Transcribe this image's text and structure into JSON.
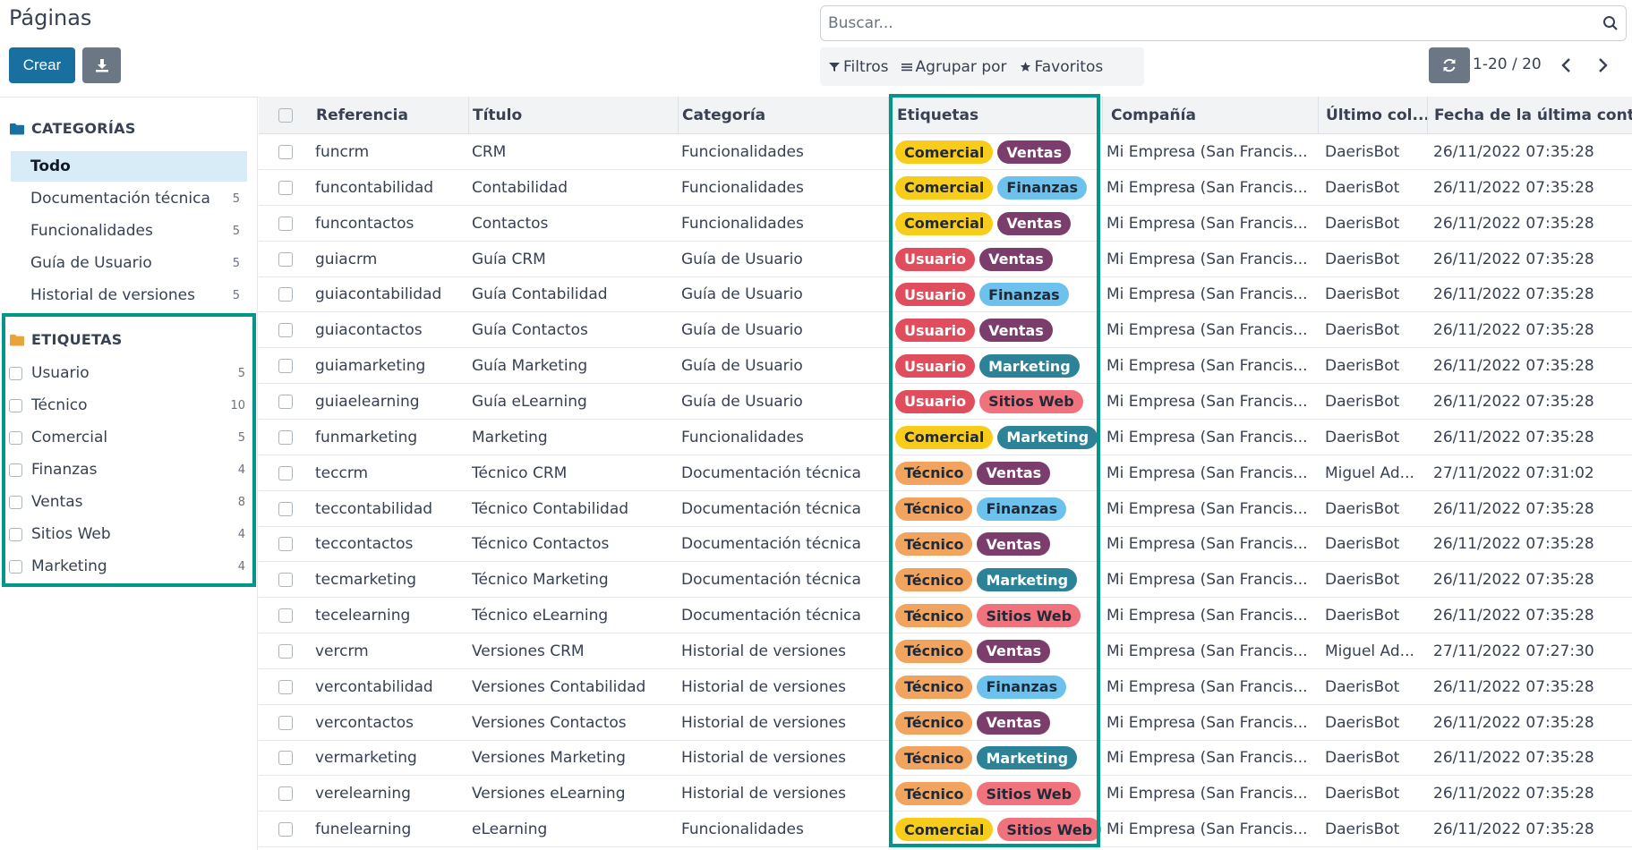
{
  "page": {
    "title": "Páginas"
  },
  "toolbar": {
    "create_label": "Crear",
    "download_icon": "download-icon",
    "refresh_icon": "refresh-icon"
  },
  "search": {
    "placeholder": "Buscar..."
  },
  "filters": {
    "filtros": "Filtros",
    "agrupar": "Agrupar por",
    "favoritos": "Favoritos"
  },
  "pager": {
    "text": "1-20 / 20"
  },
  "sidebar": {
    "categories_title": "CATEGORÍAS",
    "categories": [
      {
        "label": "Todo",
        "count": ""
      },
      {
        "label": "Documentación técnica",
        "count": "5"
      },
      {
        "label": "Funcionalidades",
        "count": "5"
      },
      {
        "label": "Guía de Usuario",
        "count": "5"
      },
      {
        "label": "Historial de versiones",
        "count": "5"
      }
    ],
    "tags_title": "ETIQUETAS",
    "tags": [
      {
        "label": "Usuario",
        "count": "5"
      },
      {
        "label": "Técnico",
        "count": "10"
      },
      {
        "label": "Comercial",
        "count": "5"
      },
      {
        "label": "Finanzas",
        "count": "4"
      },
      {
        "label": "Ventas",
        "count": "8"
      },
      {
        "label": "Sitios Web",
        "count": "4"
      },
      {
        "label": "Marketing",
        "count": "4"
      }
    ]
  },
  "table": {
    "columns": {
      "referencia": "Referencia",
      "titulo": "Título",
      "categoria": "Categoría",
      "etiquetas": "Etiquetas",
      "compania": "Compañía",
      "ultimo": "Último col...",
      "fecha": "Fecha de la última cont..."
    },
    "rows": [
      {
        "ref": "funcrm",
        "titulo": "CRM",
        "categoria": "Funcionalidades",
        "tag1": "Comercial",
        "tag2": "Ventas",
        "compania": "Mi Empresa (San Francis...",
        "ultimo": "DaerisBot",
        "fecha": "26/11/2022 07:35:28"
      },
      {
        "ref": "funcontabilidad",
        "titulo": "Contabilidad",
        "categoria": "Funcionalidades",
        "tag1": "Comercial",
        "tag2": "Finanzas",
        "compania": "Mi Empresa (San Francis...",
        "ultimo": "DaerisBot",
        "fecha": "26/11/2022 07:35:28"
      },
      {
        "ref": "funcontactos",
        "titulo": "Contactos",
        "categoria": "Funcionalidades",
        "tag1": "Comercial",
        "tag2": "Ventas",
        "compania": "Mi Empresa (San Francis...",
        "ultimo": "DaerisBot",
        "fecha": "26/11/2022 07:35:28"
      },
      {
        "ref": "guiacrm",
        "titulo": "Guía CRM",
        "categoria": "Guía de Usuario",
        "tag1": "Usuario",
        "tag2": "Ventas",
        "compania": "Mi Empresa (San Francis...",
        "ultimo": "DaerisBot",
        "fecha": "26/11/2022 07:35:28"
      },
      {
        "ref": "guiacontabilidad",
        "titulo": "Guía Contabilidad",
        "categoria": "Guía de Usuario",
        "tag1": "Usuario",
        "tag2": "Finanzas",
        "compania": "Mi Empresa (San Francis...",
        "ultimo": "DaerisBot",
        "fecha": "26/11/2022 07:35:28"
      },
      {
        "ref": "guiacontactos",
        "titulo": "Guía Contactos",
        "categoria": "Guía de Usuario",
        "tag1": "Usuario",
        "tag2": "Ventas",
        "compania": "Mi Empresa (San Francis...",
        "ultimo": "DaerisBot",
        "fecha": "26/11/2022 07:35:28"
      },
      {
        "ref": "guiamarketing",
        "titulo": "Guía Marketing",
        "categoria": "Guía de Usuario",
        "tag1": "Usuario",
        "tag2": "Marketing",
        "compania": "Mi Empresa (San Francis...",
        "ultimo": "DaerisBot",
        "fecha": "26/11/2022 07:35:28"
      },
      {
        "ref": "guiaelearning",
        "titulo": "Guía eLearning",
        "categoria": "Guía de Usuario",
        "tag1": "Usuario",
        "tag2": "Sitios Web",
        "compania": "Mi Empresa (San Francis...",
        "ultimo": "DaerisBot",
        "fecha": "26/11/2022 07:35:28"
      },
      {
        "ref": "funmarketing",
        "titulo": "Marketing",
        "categoria": "Funcionalidades",
        "tag1": "Comercial",
        "tag2": "Marketing",
        "compania": "Mi Empresa (San Francis...",
        "ultimo": "DaerisBot",
        "fecha": "26/11/2022 07:35:28"
      },
      {
        "ref": "teccrm",
        "titulo": "Técnico CRM",
        "categoria": "Documentación técnica",
        "tag1": "Técnico",
        "tag2": "Ventas",
        "compania": "Mi Empresa (San Francis...",
        "ultimo": "Miguel Ad...",
        "fecha": "27/11/2022 07:31:02"
      },
      {
        "ref": "teccontabilidad",
        "titulo": "Técnico Contabilidad",
        "categoria": "Documentación técnica",
        "tag1": "Técnico",
        "tag2": "Finanzas",
        "compania": "Mi Empresa (San Francis...",
        "ultimo": "DaerisBot",
        "fecha": "26/11/2022 07:35:28"
      },
      {
        "ref": "teccontactos",
        "titulo": "Técnico Contactos",
        "categoria": "Documentación técnica",
        "tag1": "Técnico",
        "tag2": "Ventas",
        "compania": "Mi Empresa (San Francis...",
        "ultimo": "DaerisBot",
        "fecha": "26/11/2022 07:35:28"
      },
      {
        "ref": "tecmarketing",
        "titulo": "Técnico Marketing",
        "categoria": "Documentación técnica",
        "tag1": "Técnico",
        "tag2": "Marketing",
        "compania": "Mi Empresa (San Francis...",
        "ultimo": "DaerisBot",
        "fecha": "26/11/2022 07:35:28"
      },
      {
        "ref": "tecelearning",
        "titulo": "Técnico eLearning",
        "categoria": "Documentación técnica",
        "tag1": "Técnico",
        "tag2": "Sitios Web",
        "compania": "Mi Empresa (San Francis...",
        "ultimo": "DaerisBot",
        "fecha": "26/11/2022 07:35:28"
      },
      {
        "ref": "vercrm",
        "titulo": "Versiones CRM",
        "categoria": "Historial de versiones",
        "tag1": "Técnico",
        "tag2": "Ventas",
        "compania": "Mi Empresa (San Francis...",
        "ultimo": "Miguel Ad...",
        "fecha": "27/11/2022 07:27:30"
      },
      {
        "ref": "vercontabilidad",
        "titulo": "Versiones Contabilidad",
        "categoria": "Historial de versiones",
        "tag1": "Técnico",
        "tag2": "Finanzas",
        "compania": "Mi Empresa (San Francis...",
        "ultimo": "DaerisBot",
        "fecha": "26/11/2022 07:35:28"
      },
      {
        "ref": "vercontactos",
        "titulo": "Versiones Contactos",
        "categoria": "Historial de versiones",
        "tag1": "Técnico",
        "tag2": "Ventas",
        "compania": "Mi Empresa (San Francis...",
        "ultimo": "DaerisBot",
        "fecha": "26/11/2022 07:35:28"
      },
      {
        "ref": "vermarketing",
        "titulo": "Versiones Marketing",
        "categoria": "Historial de versiones",
        "tag1": "Técnico",
        "tag2": "Marketing",
        "compania": "Mi Empresa (San Francis...",
        "ultimo": "DaerisBot",
        "fecha": "26/11/2022 07:35:28"
      },
      {
        "ref": "verelearning",
        "titulo": "Versiones eLearning",
        "categoria": "Historial de versiones",
        "tag1": "Técnico",
        "tag2": "Sitios Web",
        "compania": "Mi Empresa (San Francis...",
        "ultimo": "DaerisBot",
        "fecha": "26/11/2022 07:35:28"
      },
      {
        "ref": "funelearning",
        "titulo": "eLearning",
        "categoria": "Funcionalidades",
        "tag1": "Comercial",
        "tag2": "Sitios Web",
        "compania": "Mi Empresa (San Francis...",
        "ultimo": "DaerisBot",
        "fecha": "26/11/2022 07:35:28"
      }
    ]
  },
  "tag_colors": {
    "Comercial": {
      "bg": "#f8cc1b",
      "fg": "#1f2937"
    },
    "Usuario": {
      "bg": "#e04e5d",
      "fg": "#ffffff"
    },
    "Técnico": {
      "bg": "#f2a35e",
      "fg": "#1f2937"
    },
    "Ventas": {
      "bg": "#7b3d6b",
      "fg": "#ffffff"
    },
    "Finanzas": {
      "bg": "#6cc1ed",
      "fg": "#1f2937"
    },
    "Marketing": {
      "bg": "#2c8397",
      "fg": "#ffffff"
    },
    "Sitios Web": {
      "bg": "#f0727d",
      "fg": "#1f2937"
    }
  },
  "colors": {
    "primary": "#1a6fa1",
    "highlight": "#009688",
    "active_item": "#d8ecf8"
  }
}
